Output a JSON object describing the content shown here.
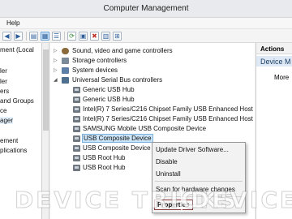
{
  "window": {
    "title": "Computer Management"
  },
  "menu": {
    "help_label": "Help"
  },
  "toolbar": {
    "icons": [
      "back-arrow-icon",
      "forward-arrow-icon",
      "up-folder-icon",
      "show-tree-icon",
      "properties-icon",
      "help-icon",
      "scan-icon",
      "update-icon",
      "disable-icon",
      "uninstall-icon",
      "refresh-icon"
    ]
  },
  "left_tree": {
    "items": [
      "ment (Local",
      "",
      "",
      "ler",
      "ers",
      "and Groups",
      "ce",
      "ager",
      "",
      "ement",
      "plications"
    ]
  },
  "device_tree": {
    "rows": [
      {
        "label": "Sound, video and game controllers",
        "expander": "▷",
        "icon": "sound-icon"
      },
      {
        "label": "Storage controllers",
        "expander": "▷",
        "icon": "storage-icon"
      },
      {
        "label": "System devices",
        "expander": "▷",
        "icon": "system-icon"
      },
      {
        "label": "Universal Serial Bus controllers",
        "expander": "◢",
        "icon": "usb-category-icon"
      },
      {
        "label": "Generic USB Hub",
        "icon": "usb-icon"
      },
      {
        "label": "Generic USB Hub",
        "icon": "usb-icon"
      },
      {
        "label": "Intel(R) 7 Series/C216 Chipset Family USB Enhanced Host",
        "icon": "usb-icon"
      },
      {
        "label": "Intel(R) 7 Series/C216 Chipset Family USB Enhanced Host",
        "icon": "usb-icon"
      },
      {
        "label": "SAMSUNG Mobile USB Composite Device",
        "icon": "usb-icon"
      },
      {
        "label": "USB Composite Device",
        "icon": "usb-icon",
        "selected": true
      },
      {
        "label": "USB Composite Device",
        "icon": "usb-icon"
      },
      {
        "label": "USB Root Hub",
        "icon": "usb-icon"
      },
      {
        "label": "USB Root Hub",
        "icon": "usb-icon"
      }
    ]
  },
  "actions": {
    "header": "Actions",
    "section": "Device M",
    "more": "More"
  },
  "context_menu": {
    "update": "Update Driver Software...",
    "disable": "Disable",
    "uninstall": "Uninstall",
    "scan": "Scan for hardware changes",
    "properties": "Properties"
  },
  "watermark": {
    "left": "DEVICE TRICKS",
    "right": "DEVICE"
  }
}
